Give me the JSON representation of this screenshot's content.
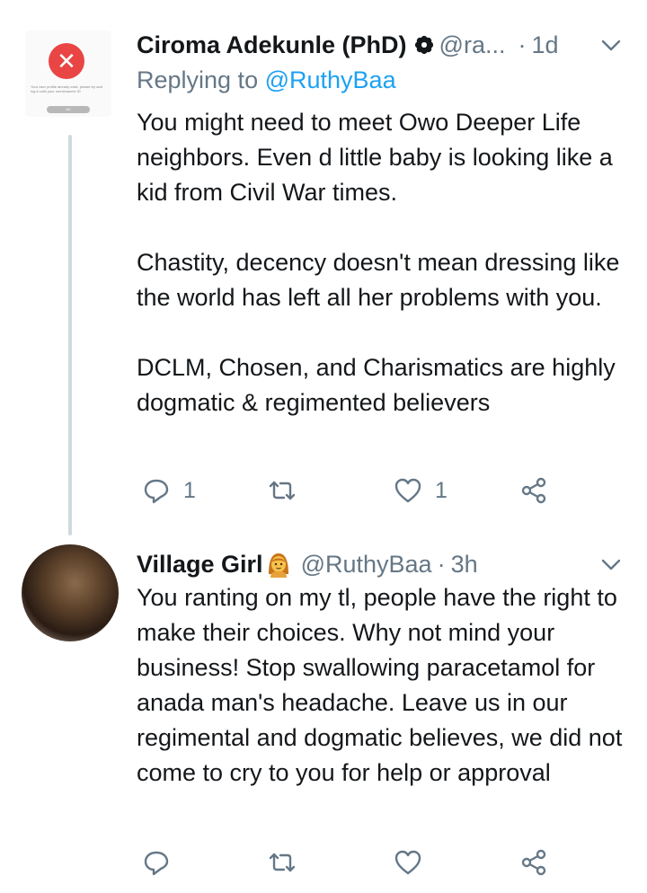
{
  "tweets": [
    {
      "display_name": "Ciroma Adekunle (PhD)",
      "verified_icon": "flower-badge-icon",
      "handle": "@ra...",
      "separator": "·",
      "timestamp": "1d",
      "replying_prefix": "Replying to",
      "replying_to": "@RuthyBaa",
      "paragraphs": [
        "You might need to meet Owo Deeper Life neighbors. Even d little baby is looking like a kid from Civil War times.",
        "Chastity, decency doesn't mean dressing like the world has left all her problems with you.",
        "DCLM, Chosen, and Charismatics are highly dogmatic & regimented believers"
      ],
      "avatar_dialog": {
        "message": "Your user profile already exist, please try and log in with your omnichannel ID",
        "button": "OK"
      },
      "reply_count": "1",
      "retweet_count": "",
      "like_count": "1"
    },
    {
      "display_name": "Village Girl",
      "emoji_icon": "woman-emoji-icon",
      "handle": "@RuthyBaa",
      "separator": "·",
      "timestamp": "3h",
      "paragraphs": [
        "You ranting on my tl, people have the right to make their choices. Why not mind your business! Stop swallowing paracetamol for anada man's headache. Leave us in our regimental and dogmatic believes, we did not come to cry to you for help or approval"
      ],
      "reply_count": "",
      "retweet_count": "",
      "like_count": ""
    }
  ],
  "colors": {
    "text": "#14171a",
    "secondary": "#657786",
    "link": "#1da1f2",
    "thread_line": "#cfd9de"
  }
}
